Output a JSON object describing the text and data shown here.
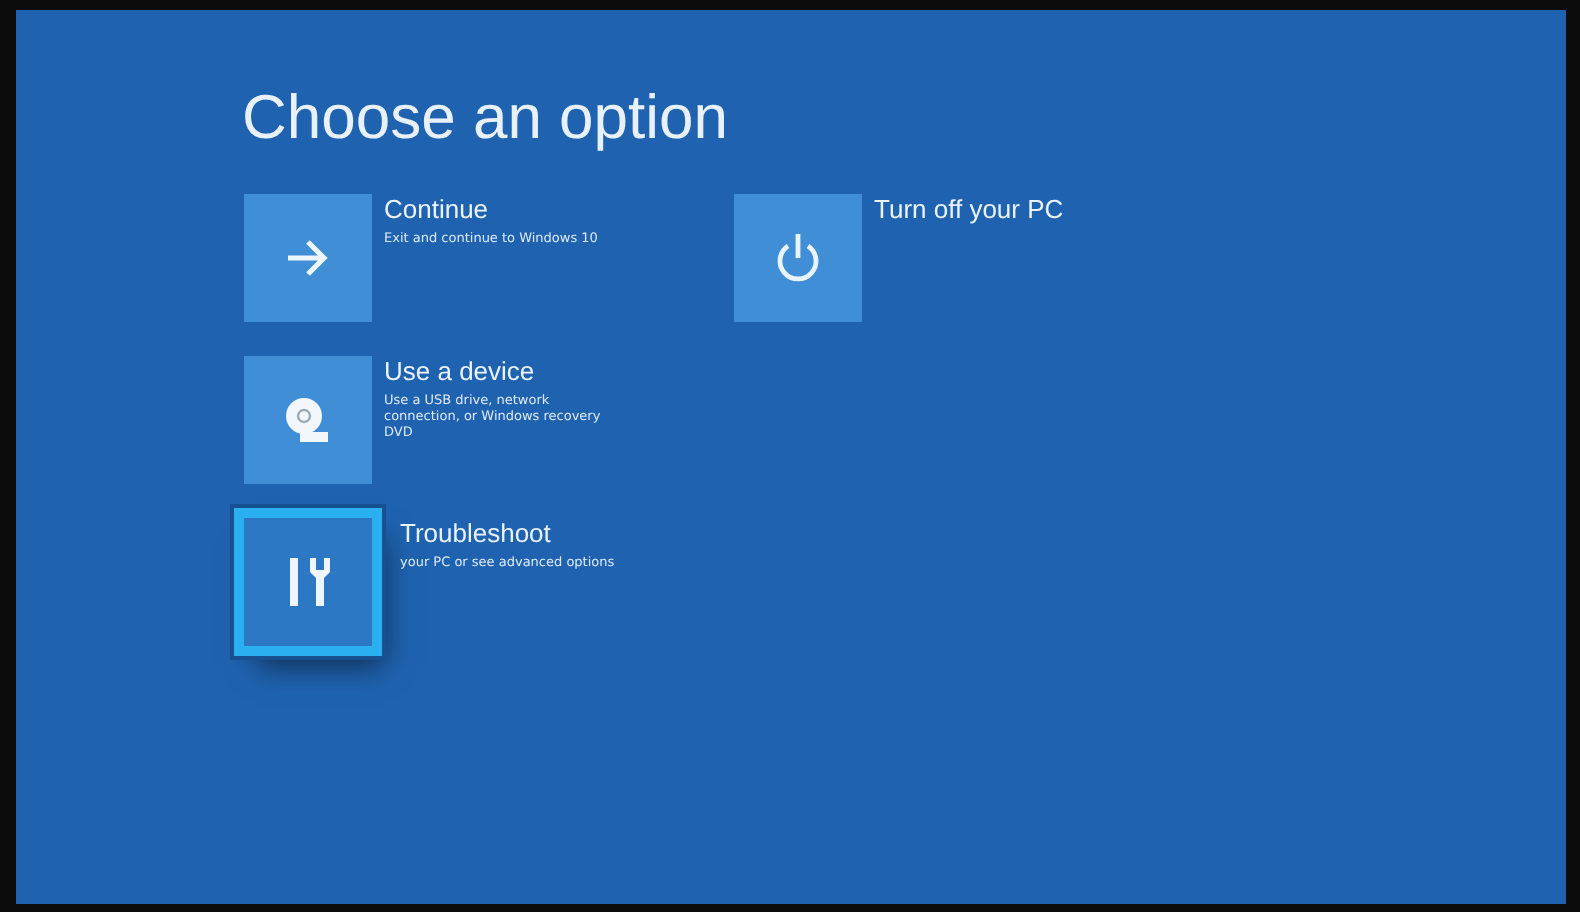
{
  "title": "Choose an option",
  "options": [
    {
      "kind": "continue",
      "label": "Continue",
      "description": "Exit and continue to Windows 10",
      "selected": false
    },
    {
      "kind": "device",
      "label": "Use a device",
      "description": "Use a USB drive, network connection, or Windows recovery DVD",
      "selected": false
    },
    {
      "kind": "troubleshoot",
      "label": "Troubleshoot",
      "description": "your PC or see advanced options",
      "selected": true
    },
    {
      "kind": "power",
      "label": "Turn off your PC",
      "selected": false
    }
  ]
}
